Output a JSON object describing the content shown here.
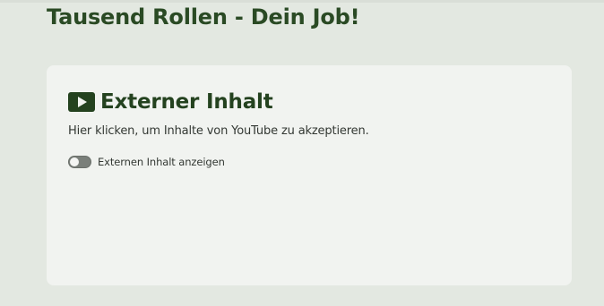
{
  "page": {
    "title": "Tausend Rollen - Dein Job!"
  },
  "consent": {
    "icon": "video-play-icon",
    "title": "Externer Inhalt",
    "text": "Hier klicken, um Inhalte von YouTube zu akzeptieren.",
    "toggle": {
      "label": "Externen Inhalt anzeigen",
      "checked": false
    }
  },
  "colors": {
    "background": "#e3e8e1",
    "card": "#f1f3f0",
    "accent": "#2a4a24",
    "toggle_off": "#7a7f7a"
  }
}
